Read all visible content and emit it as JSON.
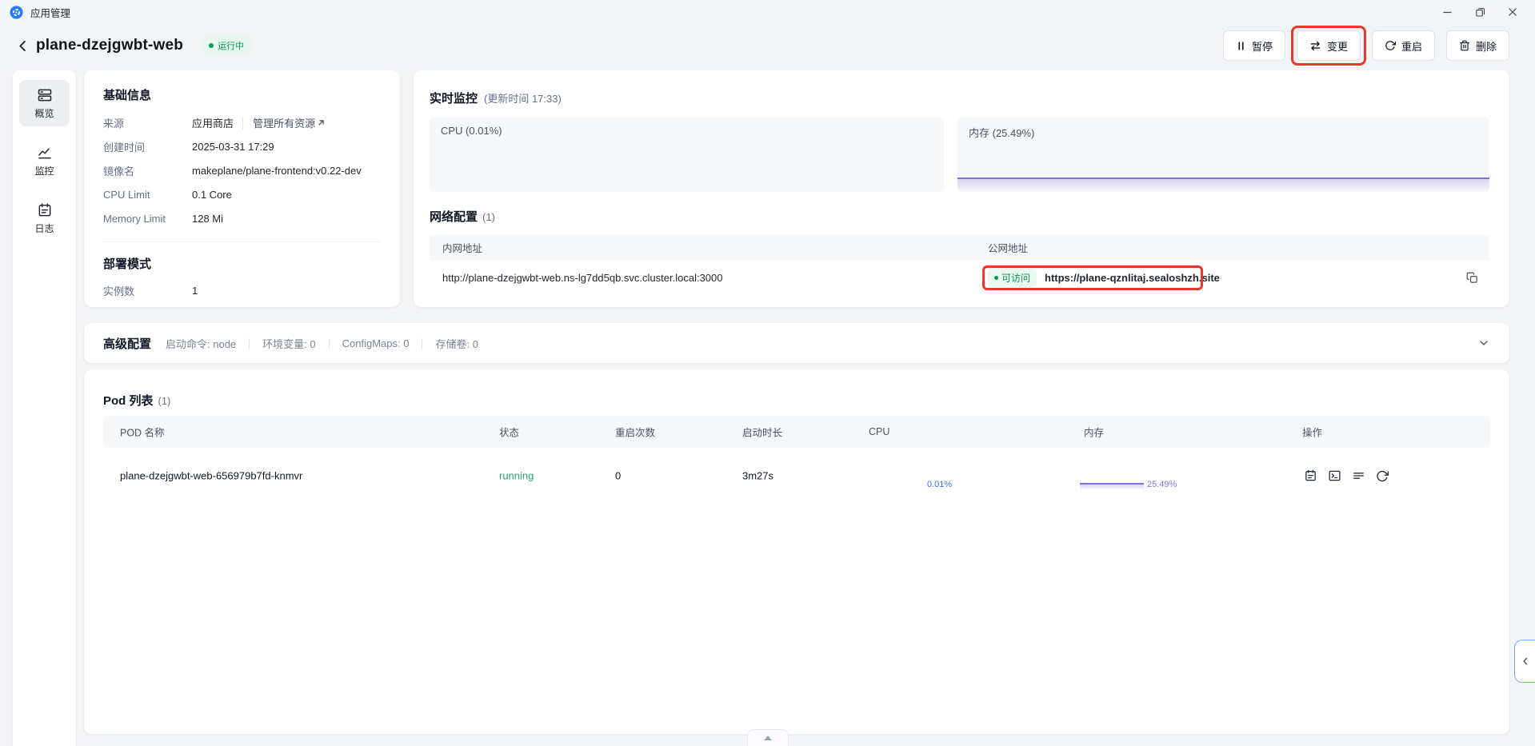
{
  "window": {
    "title": "应用管理"
  },
  "header": {
    "app_name": "plane-dzejgwbt-web",
    "status_badge": "运行中",
    "pause_label": "暂停",
    "change_label": "变更",
    "restart_label": "重启",
    "delete_label": "删除"
  },
  "sidebar": {
    "items": [
      {
        "label": "概览"
      },
      {
        "label": "监控"
      },
      {
        "label": "日志"
      }
    ]
  },
  "basic_info": {
    "title": "基础信息",
    "source_label": "来源",
    "source_value": "应用商店",
    "source_link": "管理所有资源",
    "rows": [
      {
        "label": "创建时间",
        "value": "2025-03-31 17:29"
      },
      {
        "label": "镜像名",
        "value": "makeplane/plane-frontend:v0.22-dev"
      },
      {
        "label": "CPU Limit",
        "value": "0.1 Core"
      },
      {
        "label": "Memory Limit",
        "value": "128 Mi"
      }
    ],
    "deploy_title": "部署模式",
    "instance_label": "实例数",
    "instance_value": "1"
  },
  "monitor": {
    "title": "实时监控",
    "subtitle": "(更新时间 17:33)",
    "cpu_title": "CPU (0.01%)",
    "mem_title": "内存 (25.49%)"
  },
  "network": {
    "title": "网络配置",
    "count": "(1)",
    "internal_header": "内网地址",
    "external_header": "公网地址",
    "internal_address": "http://plane-dzejgwbt-web.ns-lg7dd5qb.svc.cluster.local:3000",
    "badge": "可访问",
    "external_url": "https://plane-qznlitaj.sealoshzh.site"
  },
  "advanced": {
    "title": "高级配置",
    "items": [
      "启动命令: node",
      "环境变量: 0",
      "ConfigMaps: 0",
      "存储卷: 0"
    ]
  },
  "pods": {
    "title": "Pod 列表",
    "count": "(1)",
    "headers": [
      "POD 名称",
      "状态",
      "重启次数",
      "启动时长",
      "CPU",
      "内存",
      "操作"
    ],
    "rows": [
      {
        "name": "plane-dzejgwbt-web-656979b7fd-knmvr",
        "status": "running",
        "restarts": "0",
        "age": "3m27s",
        "cpu": "0.01%",
        "memory": "25.49%"
      }
    ]
  },
  "colors": {
    "green": "#039855",
    "purple": "#8172d8",
    "blue": "#3370ff",
    "annotation_red": "#e8392f"
  }
}
